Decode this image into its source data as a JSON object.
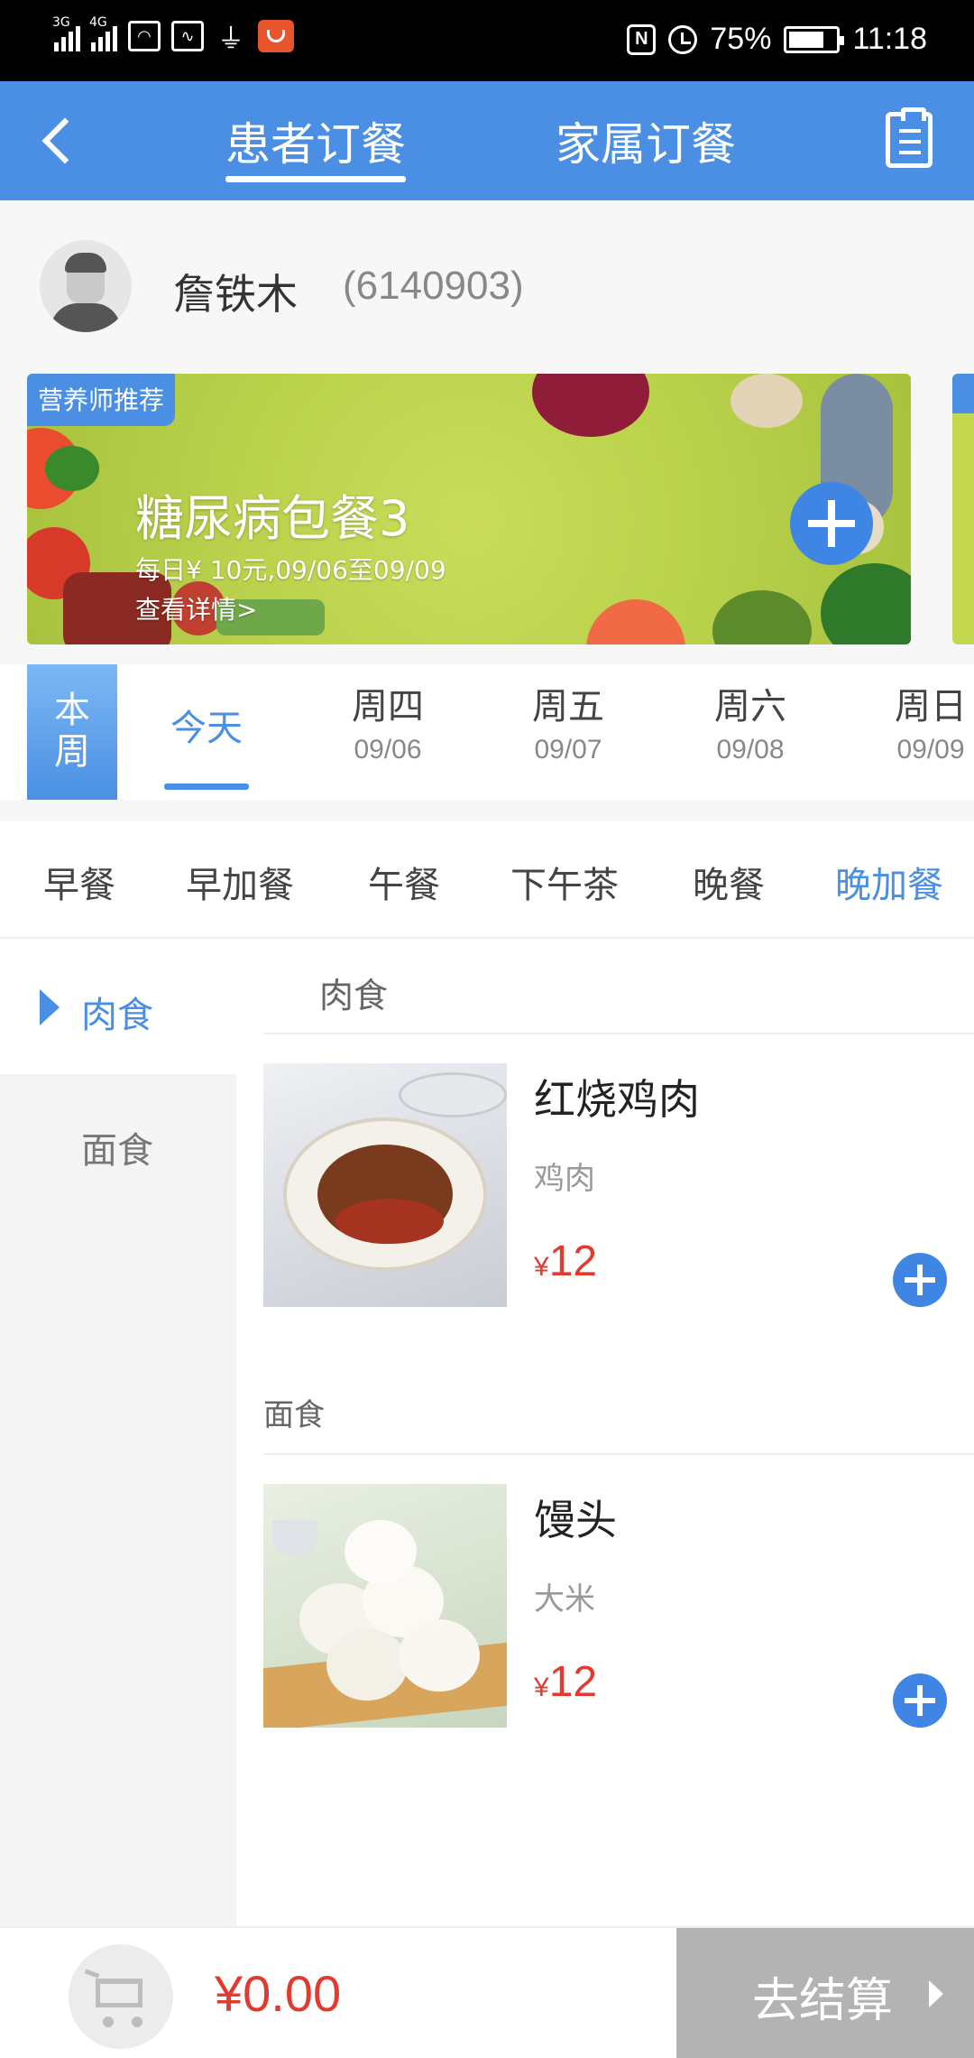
{
  "status_bar": {
    "net1": "3G",
    "net2": "4G",
    "battery_pct": "75%",
    "time": "11:18",
    "battery_level": 0.75
  },
  "header": {
    "tabs": [
      {
        "label": "患者订餐",
        "active": true
      },
      {
        "label": "家属订餐",
        "active": false
      }
    ]
  },
  "patient": {
    "name": "詹铁木",
    "id": "(6140903)"
  },
  "banner": {
    "tag": "营养师推荐",
    "title": "糖尿病包餐3",
    "subtitle": "每日¥ 10元,09/06至09/09",
    "link": "查看详情>"
  },
  "week": {
    "badge": "本周",
    "days": [
      {
        "label": "今天",
        "date": "",
        "active": true
      },
      {
        "label": "周四",
        "date": "09/06",
        "active": false
      },
      {
        "label": "周五",
        "date": "09/07",
        "active": false
      },
      {
        "label": "周六",
        "date": "09/08",
        "active": false
      },
      {
        "label": "周日",
        "date": "09/09",
        "active": false
      }
    ]
  },
  "meals": [
    {
      "label": "早餐",
      "active": false
    },
    {
      "label": "早加餐",
      "active": false
    },
    {
      "label": "午餐",
      "active": false
    },
    {
      "label": "下午茶",
      "active": false
    },
    {
      "label": "晚餐",
      "active": false
    },
    {
      "label": "晚加餐",
      "active": true
    }
  ],
  "categories": [
    {
      "label": "肉食",
      "active": true
    },
    {
      "label": "面食",
      "active": false
    }
  ],
  "sections": [
    {
      "title": "肉食",
      "dishes": [
        {
          "name": "红烧鸡肉",
          "ingredient": "鸡肉",
          "currency": "¥",
          "price": "12"
        }
      ]
    },
    {
      "title": "面食",
      "dishes": [
        {
          "name": "馒头",
          "ingredient": "大米",
          "currency": "¥",
          "price": "12"
        }
      ]
    }
  ],
  "footer": {
    "total": "¥0.00",
    "checkout_label": "去结算"
  },
  "colors": {
    "primary": "#4a8fe3",
    "price": "#e13b2f",
    "checkout_disabled": "#b3b3b3"
  }
}
